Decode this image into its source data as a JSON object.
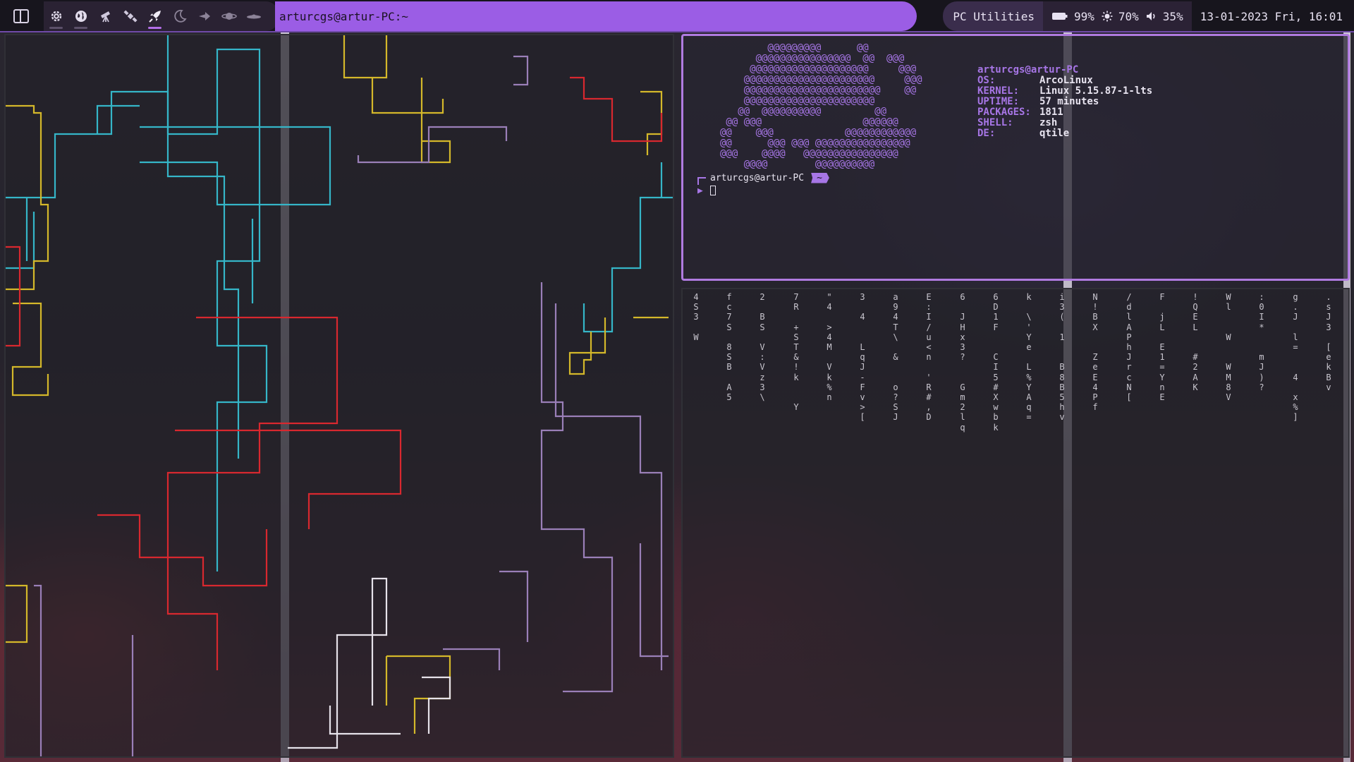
{
  "topbar": {
    "groups": [
      {
        "icon": "gear-icon",
        "state": "occupied"
      },
      {
        "icon": "globe-icon",
        "state": "occupied"
      },
      {
        "icon": "telescope-icon",
        "state": "empty"
      },
      {
        "icon": "satellite-icon",
        "state": "empty"
      },
      {
        "icon": "rocket-icon",
        "state": "active"
      },
      {
        "icon": "moon-icon",
        "state": "empty"
      },
      {
        "icon": "comet-icon",
        "state": "empty"
      },
      {
        "icon": "planet-icon",
        "state": "empty"
      },
      {
        "icon": "ufo-icon",
        "state": "empty"
      }
    ],
    "window_title": "arturcgs@artur-PC:~",
    "utilities_label": "PC Utilities",
    "battery": "99%",
    "brightness": "70%",
    "volume": "35%",
    "clock": "13-01-2023 Fri, 16:01",
    "colors": {
      "accent": "#9b5de5",
      "bar_bg": "#17151d"
    }
  },
  "neofetch": {
    "logo_lines": [
      "        @@@@@@@@@      @@",
      "      @@@@@@@@@@@@@@@@  @@  @@@",
      "     @@@@@@@@@@@@@@@@@@@@     @@@",
      "    @@@@@@@@@@@@@@@@@@@@@@     @@@",
      "    @@@@@@@@@@@@@@@@@@@@@@@    @@",
      "    @@@@@@@@@@@@@@@@@@@@@@",
      "   @@  @@@@@@@@@@         @@",
      " @@ @@@                 @@@@@@",
      "@@    @@@            @@@@@@@@@@@@",
      "@@      @@@ @@@ @@@@@@@@@@@@@@@@",
      "@@@    @@@@   @@@@@@@@@@@@@@@@",
      "    @@@@        @@@@@@@@@@"
    ],
    "header": "arturcgs@artur-PC",
    "rows": [
      {
        "key": "OS:",
        "value": "ArcoLinux"
      },
      {
        "key": "KERNEL:",
        "value": "Linux 5.15.87-1-lts"
      },
      {
        "key": "UPTIME:",
        "value": "57 minutes"
      },
      {
        "key": "PACKAGES:",
        "value": "1811"
      },
      {
        "key": "SHELL:",
        "value": "zsh"
      },
      {
        "key": "DE:",
        "value": "qtile"
      }
    ],
    "prompt_user": "arturcgs@artur-PC",
    "prompt_dir": "~",
    "prompt_arrow": "▶",
    "colors": {
      "accent": "#a776e6"
    }
  },
  "matrix": {
    "columns": [
      "4S3 W",
      "fc7S 8SB A5",
      "2 BS V:Vz3\\",
      "7R +ST&!k  Y",
      "\"4 >4M Vk%n",
      "3 4  LqJ-Fv>[",
      "a94T\\ &  o?SJ",
      "E:I/u<n 'R#,D",
      "6 JHx3?  Gm2lq",
      "6D1F  CI5#Xwbk",
      "k \\'Ye L%YAq=",
      "i3( 1  B8B5hv",
      "N!BX  ZeE4Pf",
      "/dlAPhJrcN[",
      "F jL E1=YnE",
      "!QEL  #2AK",
      "Wl  W  WM8V",
      ":0I*  mJ)?",
      "g.J l=  4 x%]",
      ".sJ3 [ekBv"
    ],
    "colors": {
      "text": "#c9c6cf"
    }
  },
  "pipes": {
    "colors": {
      "cyan": "#35b6c8",
      "yellow": "#d4b82a",
      "red": "#d8282f",
      "purple": "#9a7fb8"
    }
  }
}
